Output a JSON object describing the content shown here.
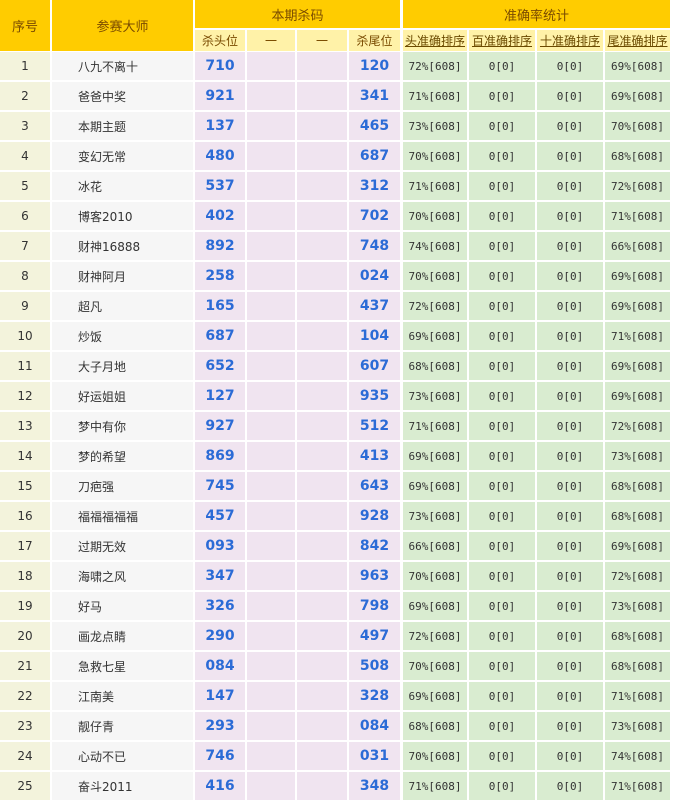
{
  "headers": {
    "index": "序号",
    "master": "参赛大师",
    "kill_group": "本期杀码",
    "stats_group": "准确率统计",
    "kill_cols": [
      "杀头位",
      "一",
      "一",
      "杀尾位"
    ],
    "stat_cols": [
      "头准确排序",
      "百准确排序",
      "十准确排序",
      "尾准确排序"
    ]
  },
  "rows": [
    {
      "idx": "1",
      "name": "八九不离十",
      "head": "710",
      "tail": "120",
      "s1": "72%[608]",
      "s2": "0[0]",
      "s3": "0[0]",
      "s4": "69%[608]"
    },
    {
      "idx": "2",
      "name": "爸爸中奖",
      "head": "921",
      "tail": "341",
      "s1": "71%[608]",
      "s2": "0[0]",
      "s3": "0[0]",
      "s4": "69%[608]"
    },
    {
      "idx": "3",
      "name": "本期主题",
      "head": "137",
      "tail": "465",
      "s1": "73%[608]",
      "s2": "0[0]",
      "s3": "0[0]",
      "s4": "70%[608]"
    },
    {
      "idx": "4",
      "name": "变幻无常",
      "head": "480",
      "tail": "687",
      "s1": "70%[608]",
      "s2": "0[0]",
      "s3": "0[0]",
      "s4": "68%[608]"
    },
    {
      "idx": "5",
      "name": "冰花",
      "head": "537",
      "tail": "312",
      "s1": "71%[608]",
      "s2": "0[0]",
      "s3": "0[0]",
      "s4": "72%[608]"
    },
    {
      "idx": "6",
      "name": "博客2010",
      "head": "402",
      "tail": "702",
      "s1": "70%[608]",
      "s2": "0[0]",
      "s3": "0[0]",
      "s4": "71%[608]"
    },
    {
      "idx": "7",
      "name": "财神16888",
      "head": "892",
      "tail": "748",
      "s1": "74%[608]",
      "s2": "0[0]",
      "s3": "0[0]",
      "s4": "66%[608]"
    },
    {
      "idx": "8",
      "name": "财神阿月",
      "head": "258",
      "tail": "024",
      "s1": "70%[608]",
      "s2": "0[0]",
      "s3": "0[0]",
      "s4": "69%[608]"
    },
    {
      "idx": "9",
      "name": "超凡",
      "head": "165",
      "tail": "437",
      "s1": "72%[608]",
      "s2": "0[0]",
      "s3": "0[0]",
      "s4": "69%[608]"
    },
    {
      "idx": "10",
      "name": "炒饭",
      "head": "687",
      "tail": "104",
      "s1": "69%[608]",
      "s2": "0[0]",
      "s3": "0[0]",
      "s4": "71%[608]"
    },
    {
      "idx": "11",
      "name": "大子月地",
      "head": "652",
      "tail": "607",
      "s1": "68%[608]",
      "s2": "0[0]",
      "s3": "0[0]",
      "s4": "69%[608]"
    },
    {
      "idx": "12",
      "name": "好运姐姐",
      "head": "127",
      "tail": "935",
      "s1": "73%[608]",
      "s2": "0[0]",
      "s3": "0[0]",
      "s4": "69%[608]"
    },
    {
      "idx": "13",
      "name": "梦中有你",
      "head": "927",
      "tail": "512",
      "s1": "71%[608]",
      "s2": "0[0]",
      "s3": "0[0]",
      "s4": "72%[608]"
    },
    {
      "idx": "14",
      "name": "梦的希望",
      "head": "869",
      "tail": "413",
      "s1": "69%[608]",
      "s2": "0[0]",
      "s3": "0[0]",
      "s4": "73%[608]"
    },
    {
      "idx": "15",
      "name": "刀疤强",
      "head": "745",
      "tail": "643",
      "s1": "69%[608]",
      "s2": "0[0]",
      "s3": "0[0]",
      "s4": "68%[608]"
    },
    {
      "idx": "16",
      "name": "福福福福福",
      "head": "457",
      "tail": "928",
      "s1": "73%[608]",
      "s2": "0[0]",
      "s3": "0[0]",
      "s4": "68%[608]"
    },
    {
      "idx": "17",
      "name": "过期无效",
      "head": "093",
      "tail": "842",
      "s1": "66%[608]",
      "s2": "0[0]",
      "s3": "0[0]",
      "s4": "69%[608]"
    },
    {
      "idx": "18",
      "name": "海啸之风",
      "head": "347",
      "tail": "963",
      "s1": "70%[608]",
      "s2": "0[0]",
      "s3": "0[0]",
      "s4": "72%[608]"
    },
    {
      "idx": "19",
      "name": "好马",
      "head": "326",
      "tail": "798",
      "s1": "69%[608]",
      "s2": "0[0]",
      "s3": "0[0]",
      "s4": "73%[608]"
    },
    {
      "idx": "20",
      "name": "画龙点睛",
      "head": "290",
      "tail": "497",
      "s1": "72%[608]",
      "s2": "0[0]",
      "s3": "0[0]",
      "s4": "68%[608]"
    },
    {
      "idx": "21",
      "name": "急救七星",
      "head": "084",
      "tail": "508",
      "s1": "70%[608]",
      "s2": "0[0]",
      "s3": "0[0]",
      "s4": "68%[608]"
    },
    {
      "idx": "22",
      "name": "江南美",
      "head": "147",
      "tail": "328",
      "s1": "69%[608]",
      "s2": "0[0]",
      "s3": "0[0]",
      "s4": "71%[608]"
    },
    {
      "idx": "23",
      "name": "靓仔青",
      "head": "293",
      "tail": "084",
      "s1": "68%[608]",
      "s2": "0[0]",
      "s3": "0[0]",
      "s4": "73%[608]"
    },
    {
      "idx": "24",
      "name": "心动不已",
      "head": "746",
      "tail": "031",
      "s1": "70%[608]",
      "s2": "0[0]",
      "s3": "0[0]",
      "s4": "74%[608]"
    },
    {
      "idx": "25",
      "name": "奋斗2011",
      "head": "416",
      "tail": "348",
      "s1": "71%[608]",
      "s2": "0[0]",
      "s3": "0[0]",
      "s4": "71%[608]"
    }
  ]
}
